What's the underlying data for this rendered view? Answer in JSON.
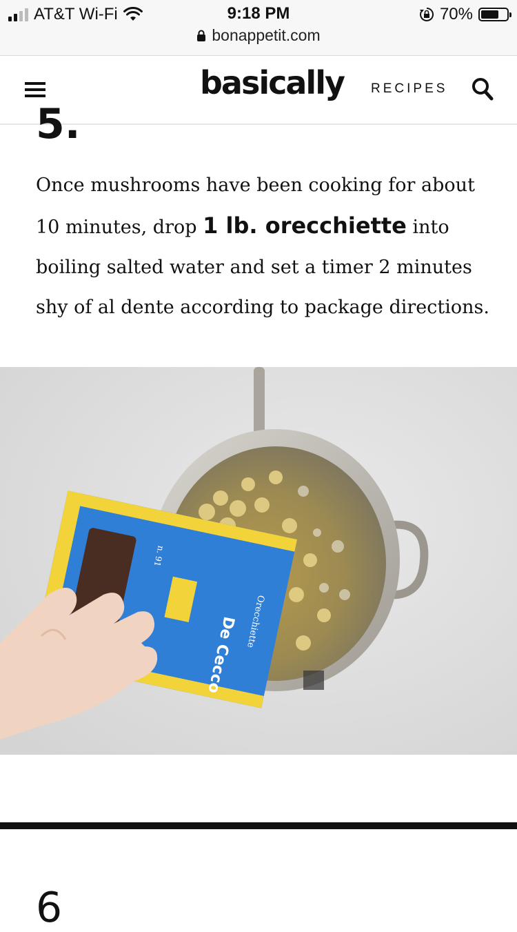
{
  "status_bar": {
    "carrier": "AT&T Wi-Fi",
    "time": "9:18 PM",
    "battery_percent": "70%",
    "battery_level": 0.7,
    "signal_bars_active": 2,
    "signal_bars_total": 4,
    "url": "bonappetit.com"
  },
  "header": {
    "logo": "basically",
    "nav_recipes": "RECIPES",
    "menu_icon": "hamburger-menu-icon",
    "search_icon": "search-icon"
  },
  "article": {
    "step5": {
      "number": "5.",
      "text_before": "Once mushrooms have been cooking for about 10 minutes, drop ",
      "ingredient": "1 lb. orecchiette",
      "text_after": " into boiling salted water and set a timer 2 minutes shy of al dente according to package directions."
    },
    "step6": {
      "number": "6"
    }
  },
  "photo": {
    "box_brand": "De Cecco",
    "box_text": "Orecchiette",
    "box_number": "n. 91"
  },
  "colors": {
    "status_bg": "#f7f7f7",
    "text": "#111111",
    "divider": "#111111",
    "box_blue": "#2f7fd6",
    "box_yellow": "#f3d33a",
    "pan": "#c9c6bf"
  }
}
